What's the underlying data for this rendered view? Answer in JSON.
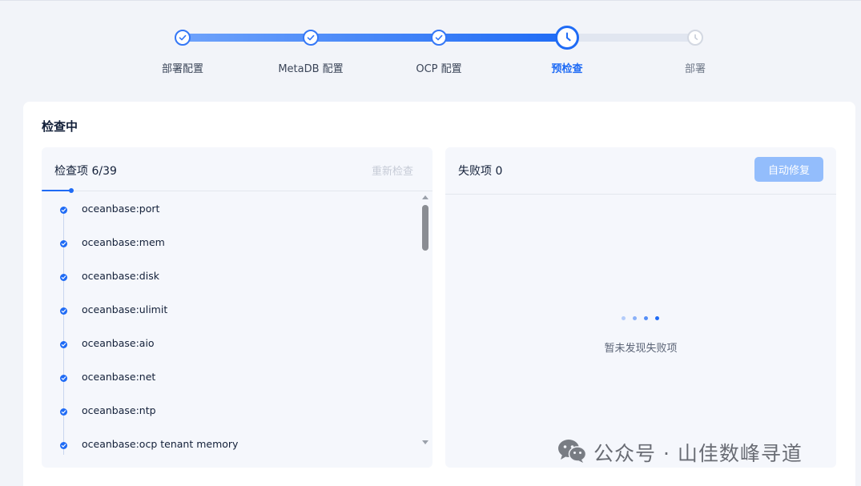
{
  "stepper": {
    "steps": [
      {
        "label": "部署配置",
        "status": "done"
      },
      {
        "label": "MetaDB 配置",
        "status": "done"
      },
      {
        "label": "OCP 配置",
        "status": "done"
      },
      {
        "label": "预检查",
        "status": "current"
      },
      {
        "label": "部署",
        "status": "pending"
      }
    ]
  },
  "card": {
    "title": "检查中"
  },
  "check_panel": {
    "title": "检查项 6/39",
    "rerun_label": "重新检查",
    "progress": {
      "completed": 6,
      "total": 39
    },
    "items": [
      "oceanbase:port",
      "oceanbase:mem",
      "oceanbase:disk",
      "oceanbase:ulimit",
      "oceanbase:aio",
      "oceanbase:net",
      "oceanbase:ntp",
      "oceanbase:ocp tenant memory"
    ]
  },
  "failed_panel": {
    "title": "失败项 0",
    "autofix_label": "自动修复",
    "empty_text": "暂未发现失败项"
  },
  "watermark": {
    "text": "公众号 · 山佳数峰寻道"
  },
  "colors": {
    "accent": "#1f6bf5",
    "accent_light": "#93bdfc",
    "background": "#f2f4f9",
    "panel": "#f5f7fc"
  },
  "icons": {
    "step_done": "check-circle-icon",
    "step_current": "clock-icon",
    "step_pending": "clock-icon",
    "item_status": "check-dot-icon",
    "watermark": "wechat-icon"
  }
}
